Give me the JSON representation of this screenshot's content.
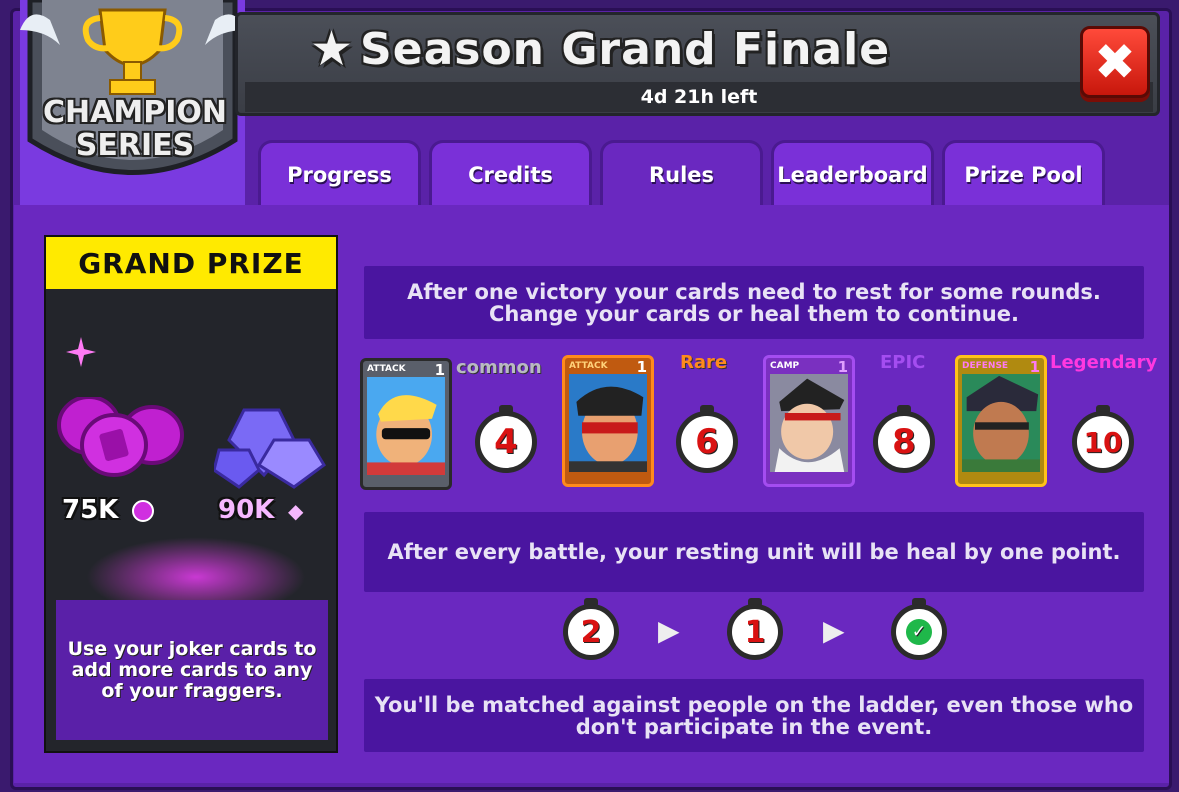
{
  "window": {
    "title": "Season Grand Finale",
    "time_left": "4d 21h left",
    "close_label": "✖"
  },
  "badge": {
    "line1": "CHAMPION",
    "line2": "SERIES"
  },
  "tabs": [
    {
      "label": "Progress"
    },
    {
      "label": "Credits"
    },
    {
      "label": "Rules"
    },
    {
      "label": "Leaderboard"
    },
    {
      "label": "Prize Pool"
    }
  ],
  "active_tab": "Rules",
  "grand_prize": {
    "header": "GRAND PRIZE",
    "coins_amount": "75K",
    "gems_amount": "90K",
    "plus": "+",
    "joker_text": "Use your joker cards to add more cards to any of your fraggers."
  },
  "rules": {
    "rest_text": "After one victory your cards need to rest for some rounds. Change your cards or heal them to continue.",
    "cards": [
      {
        "type": "ATTACK",
        "level": "1",
        "rarity": "common",
        "rest": "4"
      },
      {
        "type": "ATTACK",
        "level": "1",
        "rarity": "Rare",
        "rest": "6"
      },
      {
        "type": "CAMP",
        "level": "1",
        "rarity": "EPIC",
        "rest": "8"
      },
      {
        "type": "DEFENSE",
        "level": "1",
        "rarity": "Legendary",
        "rest": "10"
      }
    ],
    "heal_text": "After every battle, your resting unit will be heal by one point.",
    "heal_sequence": [
      "2",
      "1"
    ],
    "heal_arrow": "▶",
    "ready_mark": "✓",
    "ladder_text": "You'll be matched against people on the ladder, even those who don't participate in the event."
  },
  "colors": {
    "common": "#b9b9c2",
    "rare": "#ff8a1c",
    "epic": "#a44df0",
    "legendary": "#ff38e0",
    "timer_digit": "#d91212"
  }
}
